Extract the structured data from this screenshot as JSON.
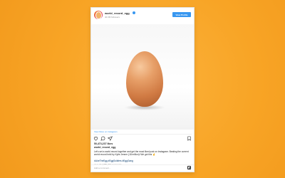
{
  "post": {
    "username": "world_record_egg",
    "subline": "40.3M followers",
    "view_profile_label": "View Profile",
    "view_more_label": "View More on Instagram",
    "likes": "50,473,237 likes",
    "owner": "world_record_egg",
    "caption": "Let's set a world record together and get the most liked post on Instagram. Beating the current world record held by Kylie Jenner (18 million)! We got this 🤞",
    "hashtags": "#LikeTheEgg #EggSoldiers #EggGang",
    "comments_link": "view all 2,880,733 comments",
    "comment_placeholder": "Add a comment..."
  },
  "colors": {
    "background": "#f8a425",
    "accent": "#3897f0",
    "egg": "#d07a43"
  },
  "icons": [
    "heart-icon",
    "comment-icon",
    "share-icon",
    "bookmark-icon",
    "instagram-icon",
    "verified-icon"
  ]
}
